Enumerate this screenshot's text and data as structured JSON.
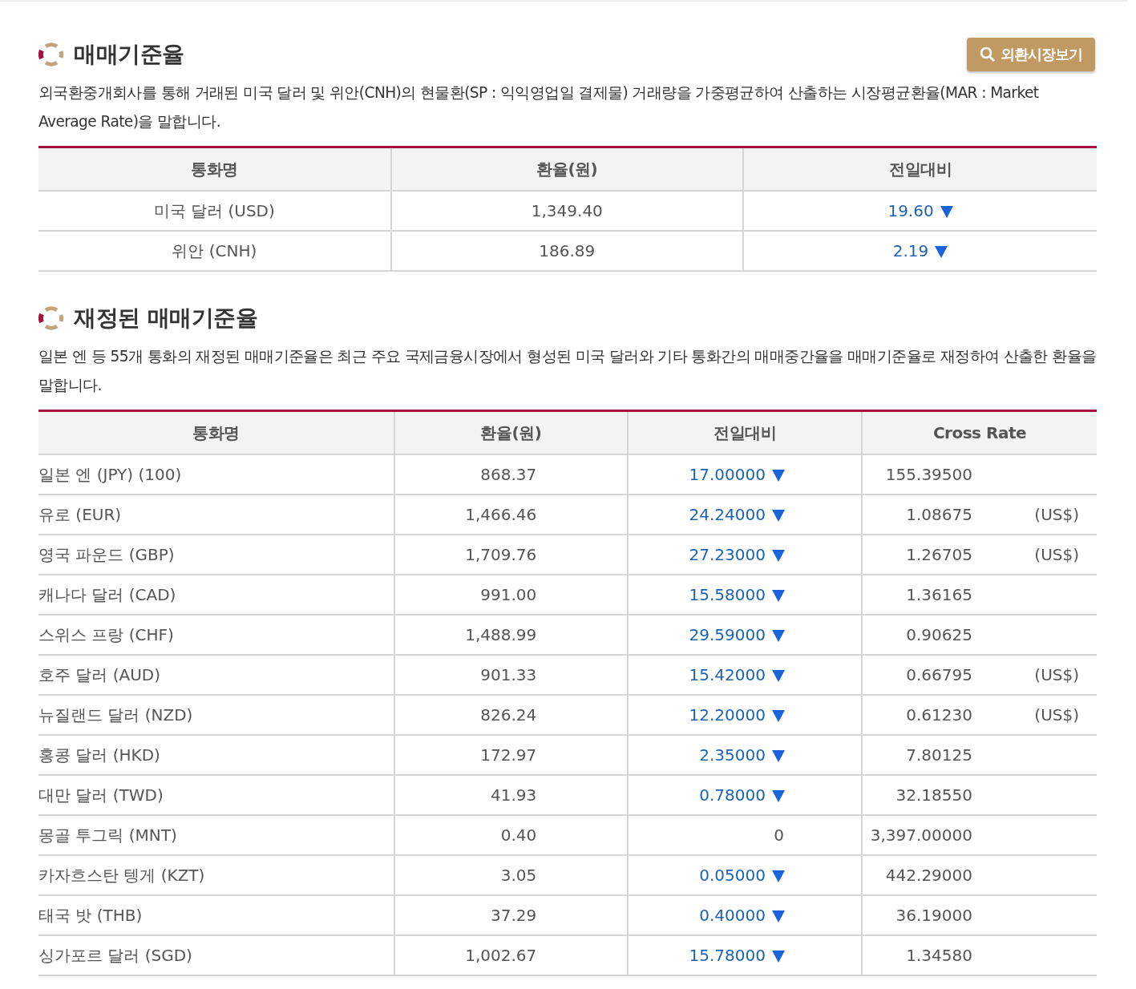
{
  "sections": [
    {
      "title": "매매기준율",
      "button": {
        "label": "외환시장보기"
      },
      "description": "외국환중개회사를 통해 거래된 미국 달러 및 위안(CNH)의 현물환(SP : 익익영업일 결제물) 거래량을 가중평균하여 산출하는 시장평균환율(MAR : Market Average Rate)을 말합니다.",
      "table": {
        "kind": "basic",
        "columns": [
          "통화명",
          "환율(원)",
          "전일대비"
        ],
        "rows": [
          {
            "currency": "미국 달러 (USD)",
            "rate": "1,349.40",
            "change": "19.60",
            "kind": "down"
          },
          {
            "currency": "위안 (CNH)",
            "rate": "186.89",
            "change": "2.19",
            "kind": "down"
          }
        ]
      }
    },
    {
      "title": "재정된 매매기준율",
      "description": "일본 엔 등 55개 통화의 재정된 매매기준율은 최근 주요 국제금융시장에서 형성된 미국 달러와 기타 통화간의 매매중간율을 매매기준율로 재정하여 산출한 환율을 말합니다.",
      "table": {
        "kind": "cross",
        "columns": [
          "통화명",
          "환율(원)",
          "전일대비",
          "Cross Rate"
        ],
        "rows": [
          {
            "currency": "일본 엔 (JPY) (100)",
            "rate": "868.37",
            "change": "17.00000",
            "kind": "down",
            "cross_rate": "155.39500"
          },
          {
            "currency": "유로 (EUR)",
            "rate": "1,466.46",
            "change": "24.24000",
            "kind": "down",
            "cross_rate": "1.08675",
            "unit": "(US$)"
          },
          {
            "currency": "영국 파운드 (GBP)",
            "rate": "1,709.76",
            "change": "27.23000",
            "kind": "down",
            "cross_rate": "1.26705",
            "unit": "(US$)"
          },
          {
            "currency": "캐나다 달러 (CAD)",
            "rate": "991.00",
            "change": "15.58000",
            "kind": "down",
            "cross_rate": "1.36165"
          },
          {
            "currency": "스위스 프랑 (CHF)",
            "rate": "1,488.99",
            "change": "29.59000",
            "kind": "down",
            "cross_rate": "0.90625"
          },
          {
            "currency": "호주 달러 (AUD)",
            "rate": "901.33",
            "change": "15.42000",
            "kind": "down",
            "cross_rate": "0.66795",
            "unit": "(US$)"
          },
          {
            "currency": "뉴질랜드 달러 (NZD)",
            "rate": "826.24",
            "change": "12.20000",
            "kind": "down",
            "cross_rate": "0.61230",
            "unit": "(US$)"
          },
          {
            "currency": "홍콩 달러 (HKD)",
            "rate": "172.97",
            "change": "2.35000",
            "kind": "down",
            "cross_rate": "7.80125"
          },
          {
            "currency": "대만 달러 (TWD)",
            "rate": "41.93",
            "change": "0.78000",
            "kind": "down",
            "cross_rate": "32.18550"
          },
          {
            "currency": "몽골 투그릭 (MNT)",
            "rate": "0.40",
            "change": "0",
            "kind": "none",
            "cross_rate": "3,397.00000"
          },
          {
            "currency": "카자흐스탄 텡게 (KZT)",
            "rate": "3.05",
            "change": "0.05000",
            "kind": "down",
            "cross_rate": "442.29000"
          },
          {
            "currency": "태국 밧 (THB)",
            "rate": "37.29",
            "change": "0.40000",
            "kind": "down",
            "cross_rate": "36.19000"
          },
          {
            "currency": "싱가포르 달러 (SGD)",
            "rate": "1,002.67",
            "change": "15.78000",
            "kind": "down",
            "cross_rate": "1.34580"
          }
        ]
      }
    }
  ]
}
